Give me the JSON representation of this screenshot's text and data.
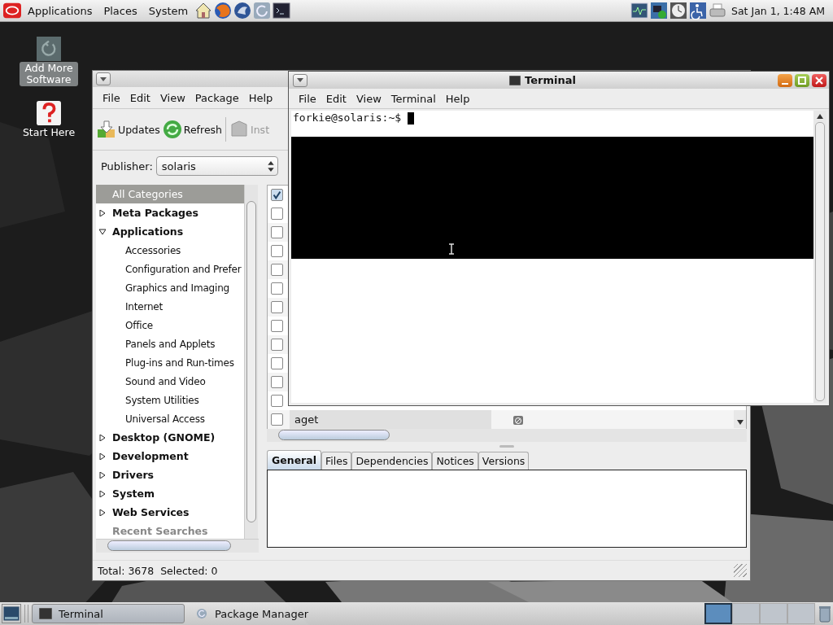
{
  "top_panel": {
    "menus": [
      "Applications",
      "Places",
      "System"
    ],
    "clock": "Sat Jan 1, 1:48 AM"
  },
  "desktop_icons": [
    {
      "kind": "software",
      "label": "Add More Software",
      "selected": true
    },
    {
      "kind": "help",
      "label": "Start Here",
      "selected": false
    }
  ],
  "package_manager": {
    "menu": [
      "File",
      "Edit",
      "View",
      "Package",
      "Help"
    ],
    "toolbar": [
      {
        "kind": "updates",
        "label": "Updates",
        "disabled": false
      },
      {
        "kind": "refresh",
        "label": "Refresh",
        "disabled": false
      },
      {
        "kind": "install",
        "label": "Inst",
        "disabled": true
      }
    ],
    "publisher_label": "Publisher:",
    "publisher": "solaris",
    "categories": [
      {
        "label": "All Categories",
        "selected": true
      },
      {
        "label": "Meta Packages",
        "selected": false,
        "expanded": false
      },
      {
        "label": "Applications",
        "selected": false,
        "expanded": true,
        "children": [
          {
            "label": "Accessories",
            "selected": false
          },
          {
            "label": "Configuration and Prefer",
            "selected": false
          },
          {
            "label": "Graphics and Imaging",
            "selected": false
          },
          {
            "label": "Internet",
            "selected": false
          },
          {
            "label": "Office",
            "selected": false
          },
          {
            "label": "Panels and Applets",
            "selected": false
          },
          {
            "label": "Plug-ins and Run-times",
            "selected": false
          },
          {
            "label": "Sound and Video",
            "selected": false
          },
          {
            "label": "System Utilities",
            "selected": false
          },
          {
            "label": "Universal Access",
            "selected": false
          }
        ]
      },
      {
        "label": "Desktop (GNOME)",
        "selected": false,
        "expanded": false
      },
      {
        "label": "Development",
        "selected": false,
        "expanded": false
      },
      {
        "label": "Drivers",
        "selected": false,
        "expanded": false
      },
      {
        "label": "System",
        "selected": false,
        "expanded": false
      },
      {
        "label": "Web Services",
        "selected": false,
        "expanded": false
      }
    ],
    "recent_searches": "Recent Searches",
    "list": {
      "header_checked": true,
      "rows": [
        {
          "checked": false
        },
        {
          "checked": false
        },
        {
          "checked": false
        },
        {
          "checked": false
        },
        {
          "checked": false
        },
        {
          "checked": false
        },
        {
          "checked": false
        },
        {
          "checked": false
        },
        {
          "checked": false
        },
        {
          "checked": false
        },
        {
          "checked": false
        },
        {
          "checked": false,
          "name": "aget"
        }
      ]
    },
    "tabs": [
      {
        "label": "General",
        "selected": true
      },
      {
        "label": "Files",
        "selected": false
      },
      {
        "label": "Dependencies",
        "selected": false
      },
      {
        "label": "Notices",
        "selected": false
      },
      {
        "label": "Versions",
        "selected": false
      }
    ],
    "status": "Total: 3678  Selected: 0"
  },
  "terminal": {
    "title": "Terminal",
    "menu": [
      "File",
      "Edit",
      "View",
      "Terminal",
      "Help"
    ],
    "prompt": "forkie@solaris:~$"
  },
  "taskbar": {
    "windows": [
      {
        "kind": "terminal",
        "label": "Terminal",
        "selected": true
      },
      {
        "kind": "package",
        "label": "Package Manager",
        "selected": false
      }
    ],
    "workspaces": [
      {
        "selected": true
      },
      {
        "selected": false
      },
      {
        "selected": false
      },
      {
        "selected": false
      }
    ]
  }
}
